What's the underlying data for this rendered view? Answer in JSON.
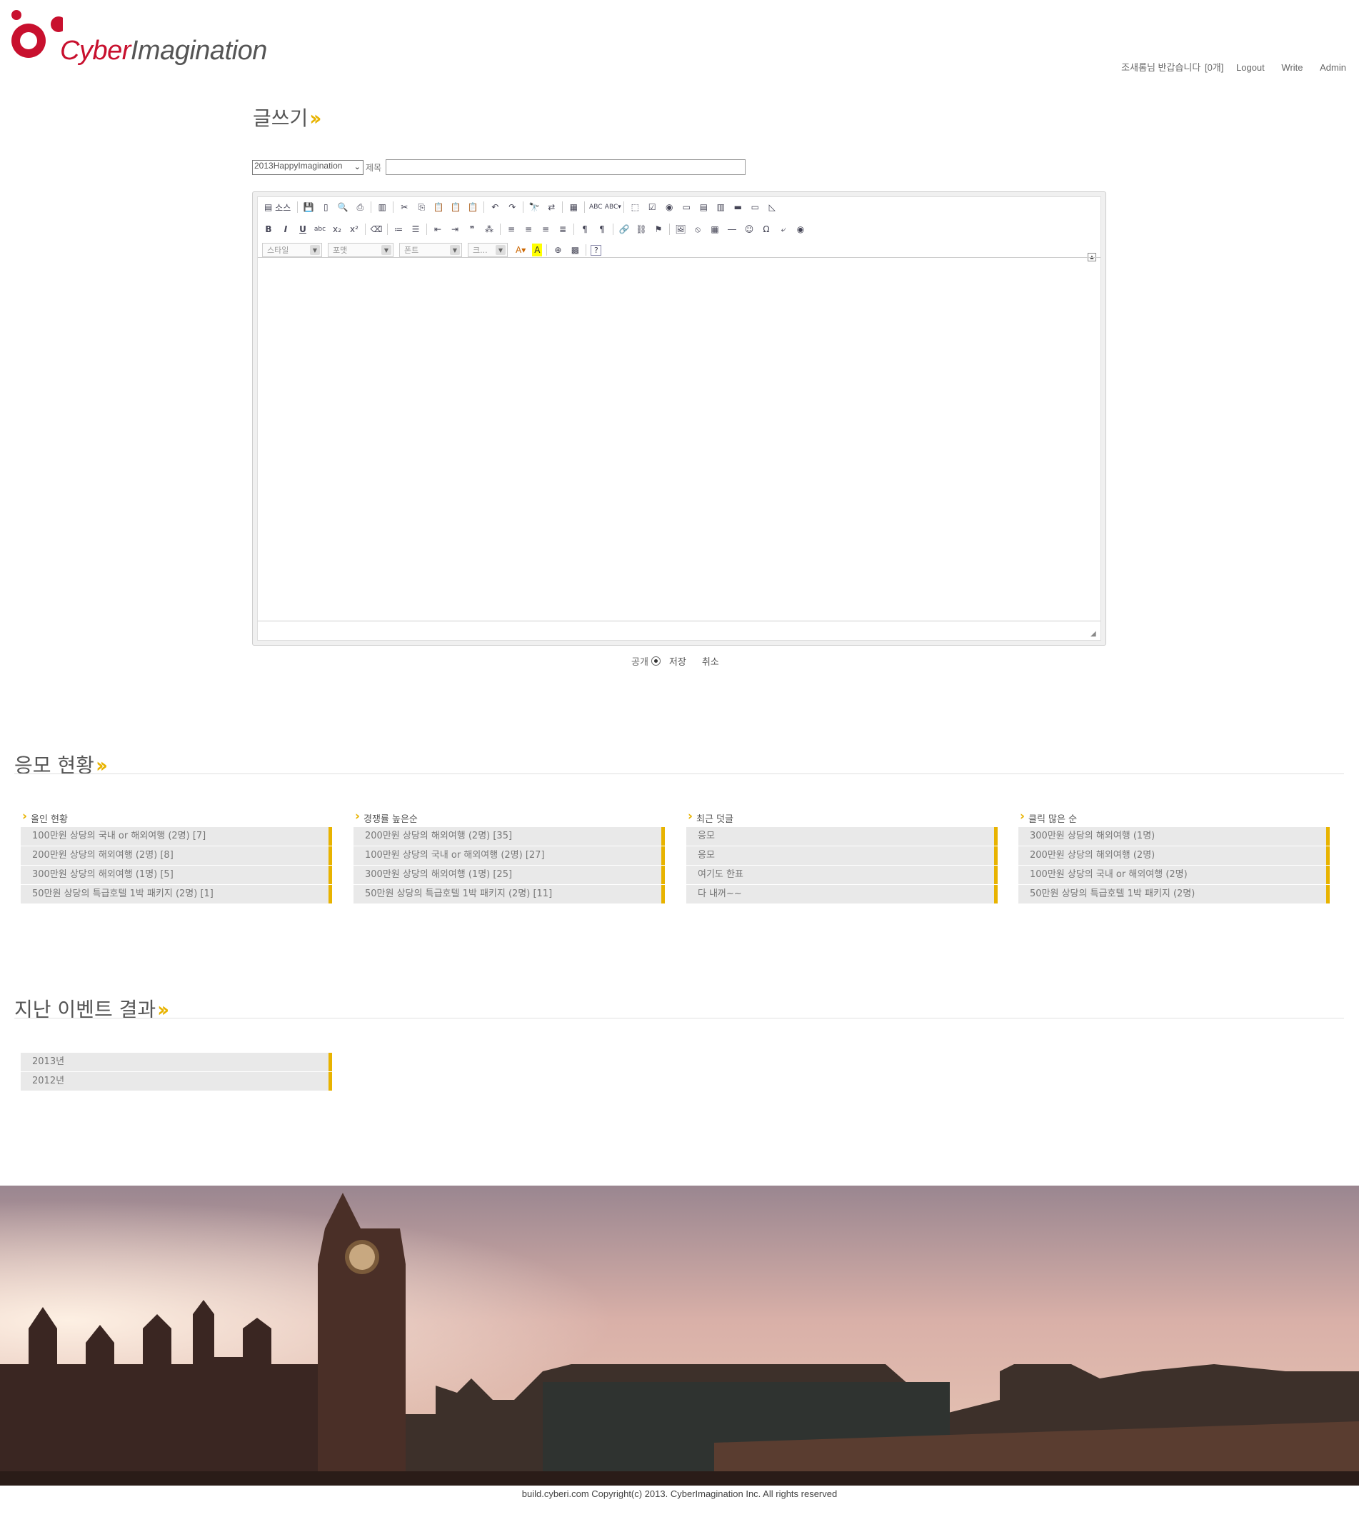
{
  "header": {
    "logo_part1": "Cyber",
    "logo_part2": "Imagination",
    "greeting": "조새롬님 반갑습니다",
    "message_count": "[0개]",
    "nav": [
      "Logout",
      "Write",
      "Admin"
    ]
  },
  "write": {
    "title": "글쓰기",
    "board_selected": "2013HappyImagination",
    "title_label": "제목",
    "title_value": "",
    "source_label": "소스",
    "combos": [
      "스타일",
      "포맷",
      "폰트",
      "크..."
    ],
    "public_label": "공개",
    "save_label": "저장",
    "cancel_label": "취소"
  },
  "status": {
    "title": "응모 현황",
    "columns": [
      {
        "title": "올인 현황",
        "items": [
          "100만원 상당의 국내 or 해외여행 (2명) [7]",
          "200만원 상당의 해외여행 (2명) [8]",
          "300만원 상당의 해외여행 (1명) [5]",
          "50만원 상당의 특급호텔 1박 패키지 (2명) [1]"
        ]
      },
      {
        "title": "경쟁률 높은순",
        "items": [
          "200만원 상당의 해외여행 (2명) [35]",
          "100만원 상당의 국내 or 해외여행 (2명) [27]",
          "300만원 상당의 해외여행 (1명) [25]",
          "50만원 상당의 특급호텔 1박 패키지 (2명) [11]"
        ]
      },
      {
        "title": "최근 덧글",
        "items": [
          "응모",
          "응모",
          "여기도 한표",
          "다 내꺼~~"
        ]
      },
      {
        "title": "클릭 많은 순",
        "items": [
          "300만원 상당의 해외여행 (1명)",
          "200만원 상당의 해외여행 (2명)",
          "100만원 상당의 국내 or 해외여행 (2명)",
          "50만원 상당의 특급호텔 1박 패키지 (2명)"
        ]
      }
    ]
  },
  "past": {
    "title": "지난 이벤트 결과",
    "items": [
      "2013년",
      "2012년"
    ]
  },
  "footer": {
    "copyright": "build.cyberi.com Copyright(c) 2013. CyberImagination Inc. All rights reserved"
  },
  "colors": {
    "accent": "#e8b300",
    "brand_red": "#c8102e"
  }
}
